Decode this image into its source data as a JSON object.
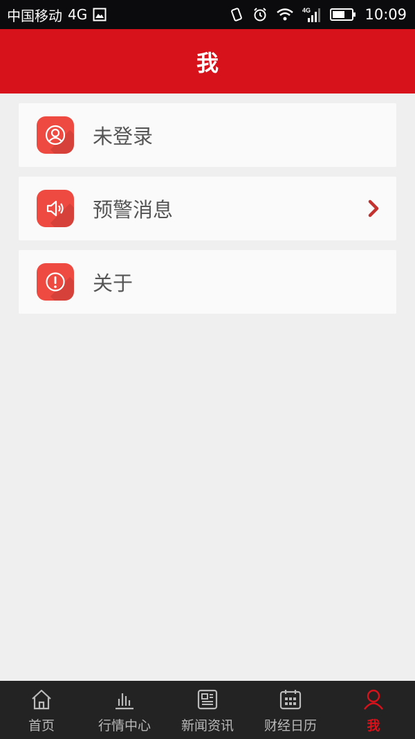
{
  "status_bar": {
    "carrier": "中国移动",
    "network": "4G",
    "signal_network": "4G",
    "time": "10:09",
    "icons": [
      "image-icon",
      "vibrate-icon",
      "alarm-icon",
      "wifi-icon",
      "signal-icon",
      "battery-icon"
    ]
  },
  "header": {
    "title": "我"
  },
  "menu": {
    "items": [
      {
        "label": "未登录",
        "icon": "user-icon",
        "has_arrow": false
      },
      {
        "label": "预警消息",
        "icon": "speaker-icon",
        "has_arrow": true
      },
      {
        "label": "关于",
        "icon": "exclamation-icon",
        "has_arrow": false
      }
    ]
  },
  "tab_bar": {
    "tabs": [
      {
        "label": "首页",
        "icon": "home-icon",
        "active": false
      },
      {
        "label": "行情中心",
        "icon": "bar-chart-icon",
        "active": false
      },
      {
        "label": "新闻资讯",
        "icon": "news-icon",
        "active": false
      },
      {
        "label": "财经日历",
        "icon": "calendar-icon",
        "active": false
      },
      {
        "label": "我",
        "icon": "person-icon",
        "active": true
      }
    ]
  },
  "colors": {
    "accent": "#d8121b",
    "icon_bg": "#ef4a41",
    "background": "#efefef",
    "card": "#fafafa",
    "tab_bar": "#232323"
  }
}
